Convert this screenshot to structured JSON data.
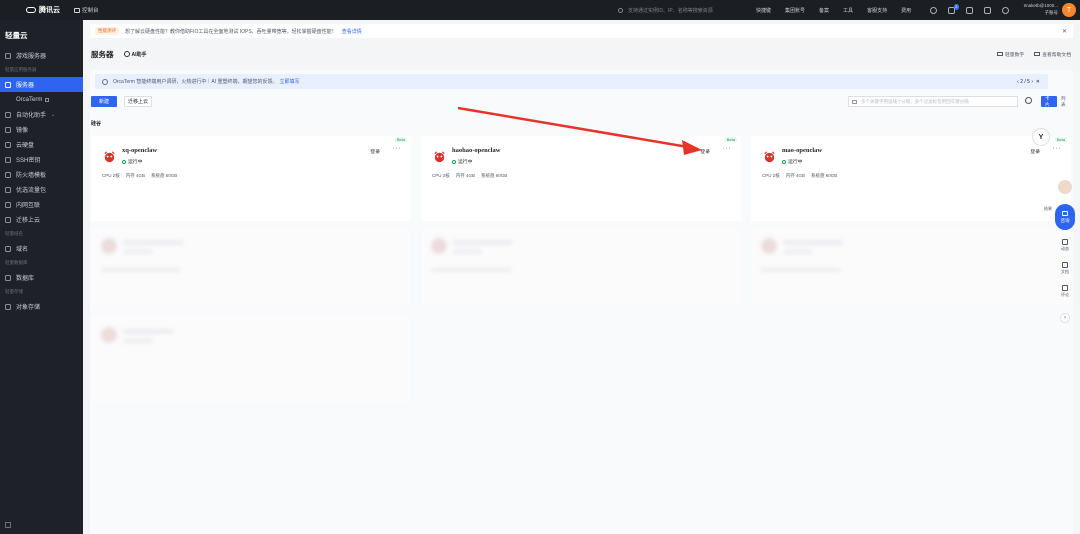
{
  "topbar": {
    "brand": "腾讯云",
    "console": "控制台",
    "search_placeholder": "支持通过实例ID、IP、名称等搜索资源",
    "nav": [
      "快捷键",
      "集团账号",
      "备案",
      "工具",
      "客服支持",
      "费用"
    ],
    "notif_count": "2",
    "user_name": "tmaketb@1000...",
    "user_sub": "子账号",
    "avatar_letter": "T"
  },
  "sidebar": {
    "title": "轻量云",
    "items_top": [
      "游戏服务器"
    ],
    "group1": "轻量应用服务器",
    "items_main": [
      "服务器",
      "OrcaTerm",
      "自动化助手",
      "镜像",
      "云硬盘",
      "SSH密钥",
      "防火墙模板",
      "优选流量包",
      "内网互联",
      "迁移上云"
    ],
    "group2": "轻量域名",
    "items_domain": [
      "域名"
    ],
    "group3": "轻量数据库",
    "items_db": [
      "数据库"
    ],
    "group4": "轻量存储",
    "items_storage": [
      "对象存储"
    ]
  },
  "notice": {
    "tag": "性能测评",
    "text": "想了解云硬盘性能？教你借助FIO工具在全面地测试 IOPS、吞吐量带宽等，轻松掌握硬盘性能！",
    "link": "查看详情"
  },
  "page": {
    "title": "服务器",
    "ai": "AI助手",
    "right1": "轻量数字",
    "right2": "查看帮助文档"
  },
  "banner": {
    "text": "OrcaTerm 智能终端用户调研，火热进行中｜AI 重塑终端，期望您的反馈。",
    "link": "立即填写",
    "pager": "2 / 5"
  },
  "toolbar": {
    "new_button": "新建",
    "migrate_button": "迁移上云",
    "filter_placeholder": "多个关键字用竖线“|”分隔，多个过滤标签用回车键分隔",
    "view_all": "卡片",
    "view_list": "列表"
  },
  "region": "硅谷",
  "cards": [
    {
      "name": "xq-openclaw",
      "status": "运行中",
      "login": "登录",
      "more": "···",
      "badge": "Beta",
      "cpu": "CPU 2核",
      "mem": "内存 4GB",
      "disk": "系统盘 60GB"
    },
    {
      "name": "haohao-openclaw",
      "status": "运行中",
      "login": "登录",
      "more": "···",
      "badge": "Beta",
      "cpu": "CPU 2核",
      "mem": "内存 4GB",
      "disk": "系统盘 60GB"
    },
    {
      "name": "mao-openclaw",
      "status": "运行中",
      "login": "登录",
      "more": "···",
      "badge": "Beta",
      "cpu": "CPU 2核",
      "mem": "内存 4GB",
      "disk": "系统盘 60GB"
    }
  ],
  "float": {
    "help_label": "结果",
    "ask": "咨询",
    "items": [
      "动态",
      "文档",
      "评论"
    ],
    "next": "›",
    "logo": "Y"
  },
  "colors": {
    "accent": "#2e64f0",
    "running": "#19a15f",
    "arrow": "#e8322c"
  }
}
